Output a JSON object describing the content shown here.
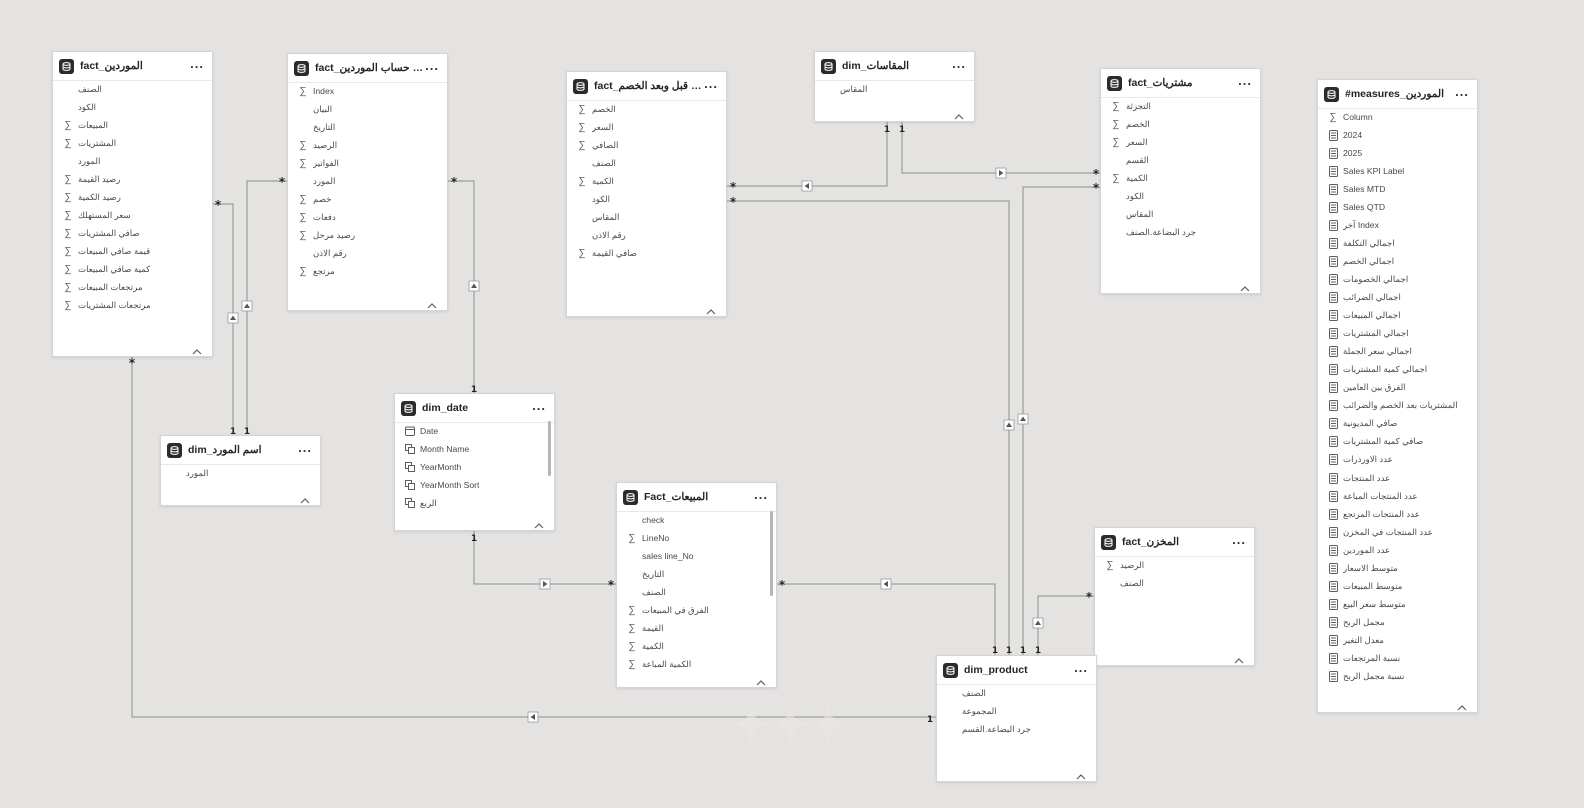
{
  "canvas": {
    "background": "#e4e3e2",
    "line_color": "#8c8c8c"
  },
  "tables": [
    {
      "id": "t1",
      "title": "fact_الموردين",
      "more": "...",
      "fields": [
        {
          "name": "الصنف",
          "icon": "none"
        },
        {
          "name": "الكود",
          "icon": "none"
        },
        {
          "name": "المبيعات",
          "icon": "sigma"
        },
        {
          "name": "المشتريات",
          "icon": "sigma"
        },
        {
          "name": "المورد",
          "icon": "none"
        },
        {
          "name": "رصيد القيمة",
          "icon": "sigma"
        },
        {
          "name": "رصيد الكمية",
          "icon": "sigma"
        },
        {
          "name": "سعر المستهلك",
          "icon": "sigma"
        },
        {
          "name": "صافي المشتريات",
          "icon": "sigma"
        },
        {
          "name": "قيمة صافي المبيعات",
          "icon": "sigma"
        },
        {
          "name": "كمية صافي المبيعات",
          "icon": "sigma"
        },
        {
          "name": "مرتجعات المبيعات",
          "icon": "sigma"
        },
        {
          "name": "مرتجعات المشتريات",
          "icon": "sigma"
        }
      ]
    },
    {
      "id": "t2",
      "title": "fact_كشف حساب الموردين",
      "more": "...",
      "fields": [
        {
          "name": "Index",
          "icon": "sigma"
        },
        {
          "name": "البيان",
          "icon": "none"
        },
        {
          "name": "التاريخ",
          "icon": "none"
        },
        {
          "name": "الرصيد",
          "icon": "sigma"
        },
        {
          "name": "الفواتير",
          "icon": "sigma"
        },
        {
          "name": "المورد",
          "icon": "none"
        },
        {
          "name": "خصم",
          "icon": "sigma"
        },
        {
          "name": "دفعات",
          "icon": "sigma"
        },
        {
          "name": "رصيد مرحل",
          "icon": "sigma"
        },
        {
          "name": "رقم الاذن",
          "icon": "none"
        },
        {
          "name": "مرتجع",
          "icon": "sigma"
        }
      ]
    },
    {
      "id": "t3",
      "title": "fact_مبيعات قبل وبعد الخصم",
      "more": "...",
      "fields": [
        {
          "name": "الخصم",
          "icon": "sigma"
        },
        {
          "name": "السعر",
          "icon": "sigma"
        },
        {
          "name": "الصافي",
          "icon": "sigma"
        },
        {
          "name": "الصنف",
          "icon": "none"
        },
        {
          "name": "الكمية",
          "icon": "sigma"
        },
        {
          "name": "الكود",
          "icon": "none"
        },
        {
          "name": "المقاس",
          "icon": "none"
        },
        {
          "name": "رقم الاذن",
          "icon": "none"
        },
        {
          "name": "صافي القيمة",
          "icon": "sigma"
        }
      ]
    },
    {
      "id": "t4",
      "title": "dim_المقاسات",
      "more": "...",
      "fields": [
        {
          "name": "المقاس",
          "icon": "none"
        }
      ]
    },
    {
      "id": "t5",
      "title": "fact_مشتريات",
      "more": "...",
      "fields": [
        {
          "name": "التجزئة",
          "icon": "sigma"
        },
        {
          "name": "الخصم",
          "icon": "sigma"
        },
        {
          "name": "السعر",
          "icon": "sigma"
        },
        {
          "name": "القسم",
          "icon": "none"
        },
        {
          "name": "الكمية",
          "icon": "sigma"
        },
        {
          "name": "الكود",
          "icon": "none"
        },
        {
          "name": "المقاس",
          "icon": "none"
        },
        {
          "name": "جرد البضاعة.الصنف",
          "icon": "none"
        }
      ]
    },
    {
      "id": "t6",
      "title": "#measures_الموردين",
      "more": "...",
      "fields": [
        {
          "name": "Column",
          "icon": "sigma"
        },
        {
          "name": "2024",
          "icon": "calc"
        },
        {
          "name": "2025",
          "icon": "calc"
        },
        {
          "name": "Sales KPI Label",
          "icon": "calc"
        },
        {
          "name": "Sales MTD",
          "icon": "calc"
        },
        {
          "name": "Sales QTD",
          "icon": "calc"
        },
        {
          "name": "آخر Index",
          "icon": "calc"
        },
        {
          "name": "اجمالي التكلفة",
          "icon": "calc"
        },
        {
          "name": "اجمالي الخصم",
          "icon": "calc"
        },
        {
          "name": "اجمالي الخصومات",
          "icon": "calc"
        },
        {
          "name": "اجمالي الضرائب",
          "icon": "calc"
        },
        {
          "name": "اجمالي المبيعات",
          "icon": "calc"
        },
        {
          "name": "اجمالي المشتريات",
          "icon": "calc"
        },
        {
          "name": "اجمالي سعر الجملة",
          "icon": "calc"
        },
        {
          "name": "اجمالي كمية المشتريات",
          "icon": "calc"
        },
        {
          "name": "الفرق بين العامين",
          "icon": "calc"
        },
        {
          "name": "المشتريات بعد الخصم والضرائب",
          "icon": "calc"
        },
        {
          "name": "صافي المديونية",
          "icon": "calc"
        },
        {
          "name": "صافي كمية المشتريات",
          "icon": "calc"
        },
        {
          "name": "عدد الاوردرات",
          "icon": "calc"
        },
        {
          "name": "عدد المنتجات",
          "icon": "calc"
        },
        {
          "name": "عدد المنتجات المباعة",
          "icon": "calc"
        },
        {
          "name": "عدد المنتجات المرتجع",
          "icon": "calc"
        },
        {
          "name": "عدد المنتجات في المخزن",
          "icon": "calc"
        },
        {
          "name": "عدد الموردين",
          "icon": "calc"
        },
        {
          "name": "متوسط الاسعار",
          "icon": "calc"
        },
        {
          "name": "متوسط المبيعات",
          "icon": "calc"
        },
        {
          "name": "متوسط سعر البيع",
          "icon": "calc"
        },
        {
          "name": "مجمل الربح",
          "icon": "calc"
        },
        {
          "name": "معدل التغير",
          "icon": "calc"
        },
        {
          "name": "نسبة المرتجعات",
          "icon": "calc"
        },
        {
          "name": "نسبة مجمل الربح",
          "icon": "calc"
        }
      ]
    },
    {
      "id": "t7",
      "title": "dim_date",
      "more": "...",
      "fields": [
        {
          "name": "Date",
          "icon": "calendar"
        },
        {
          "name": "Month Name",
          "icon": "hierarchy"
        },
        {
          "name": "YearMonth",
          "icon": "hierarchy"
        },
        {
          "name": "YearMonth Sort",
          "icon": "hierarchy"
        },
        {
          "name": "الربع",
          "icon": "hierarchy"
        }
      ]
    },
    {
      "id": "t8",
      "title": "dim_اسم المورد",
      "more": "...",
      "fields": [
        {
          "name": "المورد",
          "icon": "none"
        }
      ]
    },
    {
      "id": "t9",
      "title": "Fact_المبيعات",
      "more": "...",
      "fields": [
        {
          "name": "check",
          "icon": "none"
        },
        {
          "name": "LineNo",
          "icon": "sigma"
        },
        {
          "name": "sales line_No",
          "icon": "none"
        },
        {
          "name": "التاريخ",
          "icon": "none"
        },
        {
          "name": "الصنف",
          "icon": "none"
        },
        {
          "name": "الفرق في المبيعات",
          "icon": "sigma"
        },
        {
          "name": "القيمة",
          "icon": "sigma"
        },
        {
          "name": "الكمية",
          "icon": "sigma"
        },
        {
          "name": "الكمية المباعة",
          "icon": "sigma"
        }
      ]
    },
    {
      "id": "t10",
      "title": "fact_المخزن",
      "more": "...",
      "fields": [
        {
          "name": "الرصيد",
          "icon": "sigma"
        },
        {
          "name": "الصنف",
          "icon": "none"
        }
      ]
    },
    {
      "id": "t11",
      "title": "dim_product",
      "more": "...",
      "fields": [
        {
          "name": "الصنف",
          "icon": "none"
        },
        {
          "name": "المجموعة",
          "icon": "none"
        },
        {
          "name": "جرد البضاعة.القسم",
          "icon": "none"
        }
      ]
    }
  ],
  "relationships": [
    {
      "from": "t1",
      "to": "t8",
      "from_card": "*",
      "to_card": "1"
    },
    {
      "from": "t2",
      "to": "t8",
      "from_card": "*",
      "to_card": "1"
    },
    {
      "from": "t2",
      "to": "t7",
      "from_card": "*",
      "to_card": "1"
    },
    {
      "from": "t3",
      "to": "t4",
      "from_card": "*",
      "to_card": "1"
    },
    {
      "from": "t5",
      "to": "t4",
      "from_card": "*",
      "to_card": "1"
    },
    {
      "from": "t3",
      "to": "t11",
      "from_card": "*",
      "to_card": "1"
    },
    {
      "from": "t5",
      "to": "t11",
      "from_card": "*",
      "to_card": "1"
    },
    {
      "from": "t9",
      "to": "t7",
      "from_card": "*",
      "to_card": "1"
    },
    {
      "from": "t9",
      "to": "t11",
      "from_card": "*",
      "to_card": "1"
    },
    {
      "from": "t10",
      "to": "t11",
      "from_card": "*",
      "to_card": "1"
    },
    {
      "from": "t1",
      "to": "t11",
      "from_card": "*",
      "to_card": "1"
    }
  ]
}
